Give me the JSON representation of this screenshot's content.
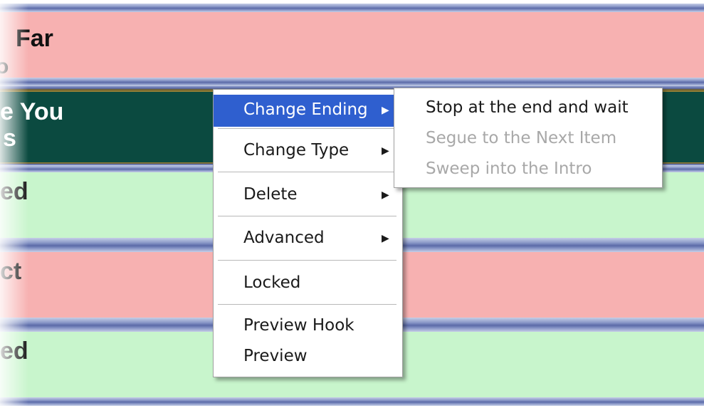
{
  "playlist": {
    "rows": [
      {
        "line1": "Far",
        "line2": "o",
        "color": "#f7b1b1"
      },
      {
        "line1": "e You",
        "line2": "s",
        "color": "#0b4a40"
      },
      {
        "line1": "ed",
        "line2": "",
        "color": "#c8f5cc"
      },
      {
        "line1": "ct",
        "line2": "",
        "color": "#f7b1b1"
      },
      {
        "line1": "ed",
        "line2": "",
        "color": "#c8f5cc"
      }
    ]
  },
  "context_menu": {
    "items": [
      {
        "label": "Change Ending",
        "submenu_arrow": "▶",
        "highlighted": true
      },
      {
        "label": "Change Type",
        "submenu_arrow": "▶"
      },
      {
        "label": "Delete",
        "submenu_arrow": "▶"
      },
      {
        "label": "Advanced",
        "submenu_arrow": "▶"
      },
      {
        "label": "Locked"
      },
      {
        "label": "Preview Hook"
      },
      {
        "label": "Preview"
      }
    ],
    "highlight_color": "#2f5fcf"
  },
  "submenu": {
    "items": [
      {
        "label": "Stop at the end and wait",
        "enabled": true
      },
      {
        "label": "Segue to the Next Item",
        "enabled": false
      },
      {
        "label": "Sweep into the Intro",
        "enabled": false
      }
    ]
  }
}
